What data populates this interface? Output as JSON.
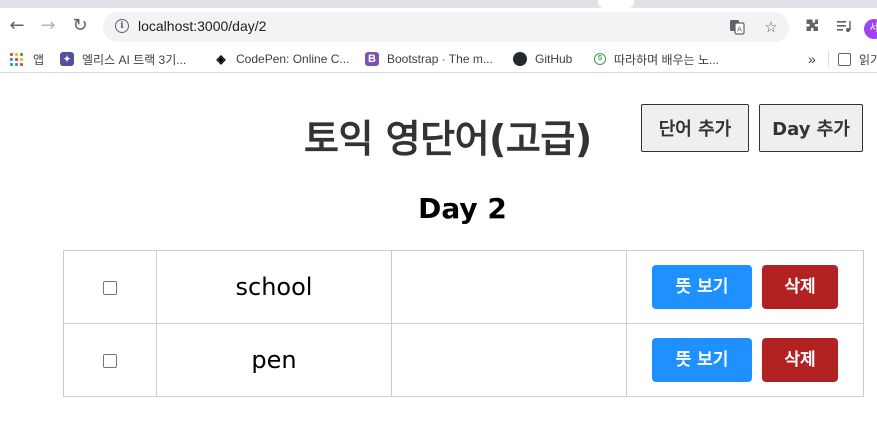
{
  "browser": {
    "url": "localhost:3000/day/2",
    "bookmarks": [
      {
        "label": "앱"
      },
      {
        "label": "엘리스 AI 트랙 3기..."
      },
      {
        "label": "CodePen: Online C..."
      },
      {
        "label": "Bootstrap · The m..."
      },
      {
        "label": "GitHub"
      },
      {
        "label": "따라하며 배우는 노..."
      },
      {
        "label": "»"
      },
      {
        "label": "읽기"
      }
    ],
    "profile_initial": "서",
    "colors": {
      "tabstrip": "#dee1e6",
      "omnibox": "#f1f3f4",
      "profile": "#a142f4"
    }
  },
  "header": {
    "title": "토익 영단어(고급)",
    "add_word_label": "단어 추가",
    "add_day_label": "Day 추가"
  },
  "day": {
    "title": "Day 2"
  },
  "words": [
    {
      "eng": "school",
      "kor": "",
      "show_label": "뜻 보기",
      "delete_label": "삭제",
      "checked": false
    },
    {
      "eng": "pen",
      "kor": "",
      "show_label": "뜻 보기",
      "delete_label": "삭제",
      "checked": false
    }
  ],
  "colors": {
    "show_button": "#1e90ff",
    "delete_button": "#b22222",
    "title_text": "#333333"
  }
}
